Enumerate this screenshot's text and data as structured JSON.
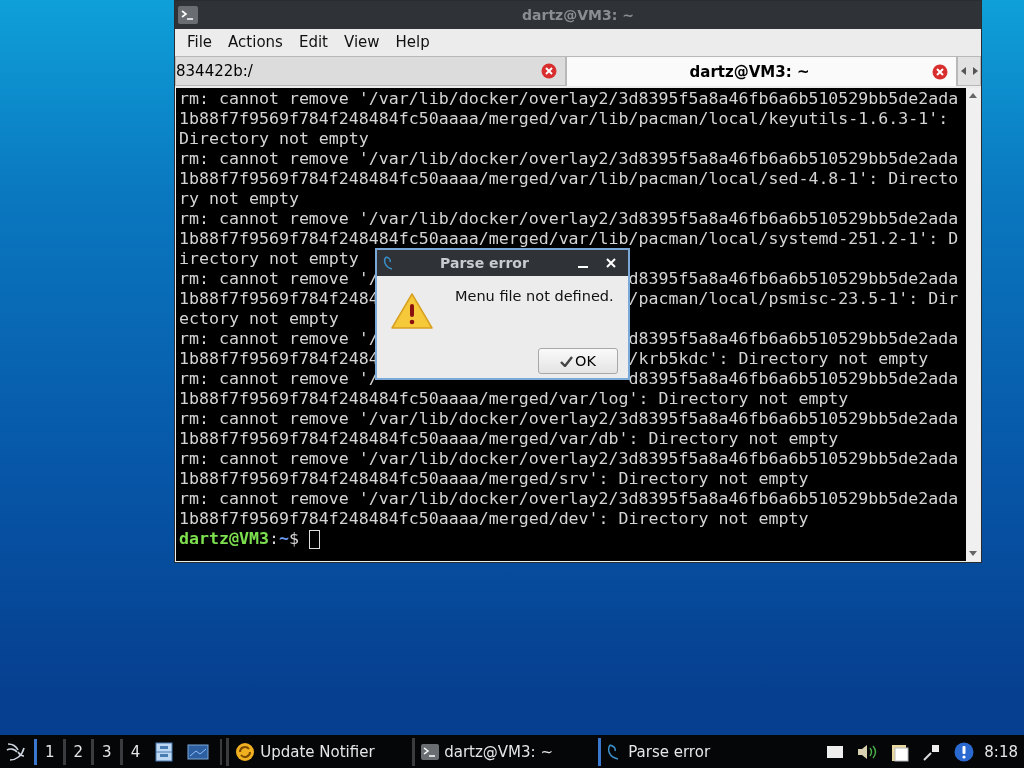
{
  "terminal_window": {
    "title": "dartz@VM3: ~",
    "menu": [
      "File",
      "Actions",
      "Edit",
      "View",
      "Help"
    ],
    "tabs": [
      {
        "label": "834422b:/",
        "selected": false
      },
      {
        "label": "dartz@VM3: ~",
        "selected": true
      }
    ],
    "lines": [
      {
        "kind": "full",
        "text": "rm: cannot remove '/var/lib/docker/overlay2/3d8395f5a8a46fb6a6b510529bb5de2ada"
      },
      {
        "kind": "full",
        "text": "1b88f7f9569f784f248484fc50aaaa/merged/var/lib/pacman/local/keyutils-1.6.3-1':"
      },
      {
        "kind": "full",
        "text": "Directory not empty"
      },
      {
        "kind": "full",
        "text": "rm: cannot remove '/var/lib/docker/overlay2/3d8395f5a8a46fb6a6b510529bb5de2ada"
      },
      {
        "kind": "full",
        "text": "1b88f7f9569f784f248484fc50aaaa/merged/var/lib/pacman/local/sed-4.8-1': Directo"
      },
      {
        "kind": "full",
        "text": "ry not empty"
      },
      {
        "kind": "full",
        "text": "rm: cannot remove '/var/lib/docker/overlay2/3d8395f5a8a46fb6a6b510529bb5de2ada"
      },
      {
        "kind": "full",
        "text": "1b88f7f9569f784f248484fc50aaaa/merged/var/lib/pacman/local/systemd-251.2-1': D"
      },
      {
        "kind": "full",
        "text": "irectory not empty"
      },
      {
        "kind": "split",
        "left": "rm: cannot remove '/",
        "right": "d8395f5a8a46fb6a6b510529bb5de2ada"
      },
      {
        "kind": "split",
        "left": "1b88f7f9569f784f2484",
        "right": "/pacman/local/psmisc-23.5-1': Dir"
      },
      {
        "kind": "full",
        "text": "ectory not empty"
      },
      {
        "kind": "split",
        "left": "rm: cannot remove '/",
        "right": "d8395f5a8a46fb6a6b510529bb5de2ada"
      },
      {
        "kind": "split",
        "left": "1b88f7f9569f784f2484",
        "right": "/krb5kdc': Directory not empty"
      },
      {
        "kind": "split",
        "left": "rm: cannot remove '/",
        "right": "d8395f5a8a46fb6a6b510529bb5de2ada"
      },
      {
        "kind": "full",
        "text": "1b88f7f9569f784f248484fc50aaaa/merged/var/log': Directory not empty"
      },
      {
        "kind": "full",
        "text": "rm: cannot remove '/var/lib/docker/overlay2/3d8395f5a8a46fb6a6b510529bb5de2ada"
      },
      {
        "kind": "full",
        "text": "1b88f7f9569f784f248484fc50aaaa/merged/var/db': Directory not empty"
      },
      {
        "kind": "full",
        "text": "rm: cannot remove '/var/lib/docker/overlay2/3d8395f5a8a46fb6a6b510529bb5de2ada"
      },
      {
        "kind": "full",
        "text": "1b88f7f9569f784f248484fc50aaaa/merged/srv': Directory not empty"
      },
      {
        "kind": "full",
        "text": "rm: cannot remove '/var/lib/docker/overlay2/3d8395f5a8a46fb6a6b510529bb5de2ada"
      },
      {
        "kind": "full",
        "text": "1b88f7f9569f784f248484fc50aaaa/merged/dev': Directory not empty"
      }
    ],
    "prompt": {
      "user_host": "dartz@VM3",
      "separator": ":",
      "path": "~",
      "symbol": "$"
    }
  },
  "dialog": {
    "title": "Parse error",
    "message": "Menu file not defined.",
    "button": "OK"
  },
  "taskbar": {
    "workspaces": [
      {
        "label": "1",
        "selected": true
      },
      {
        "label": "2",
        "selected": false
      },
      {
        "label": "3",
        "selected": false
      },
      {
        "label": "4",
        "selected": false
      }
    ],
    "tasks": [
      {
        "kind": "notifier",
        "label": "Update Notifier",
        "selected": false
      },
      {
        "kind": "terminal",
        "label": "dartz@VM3: ~",
        "selected": false
      },
      {
        "kind": "dialog",
        "label": "Parse error",
        "selected": true
      }
    ],
    "clock": "8:18"
  }
}
